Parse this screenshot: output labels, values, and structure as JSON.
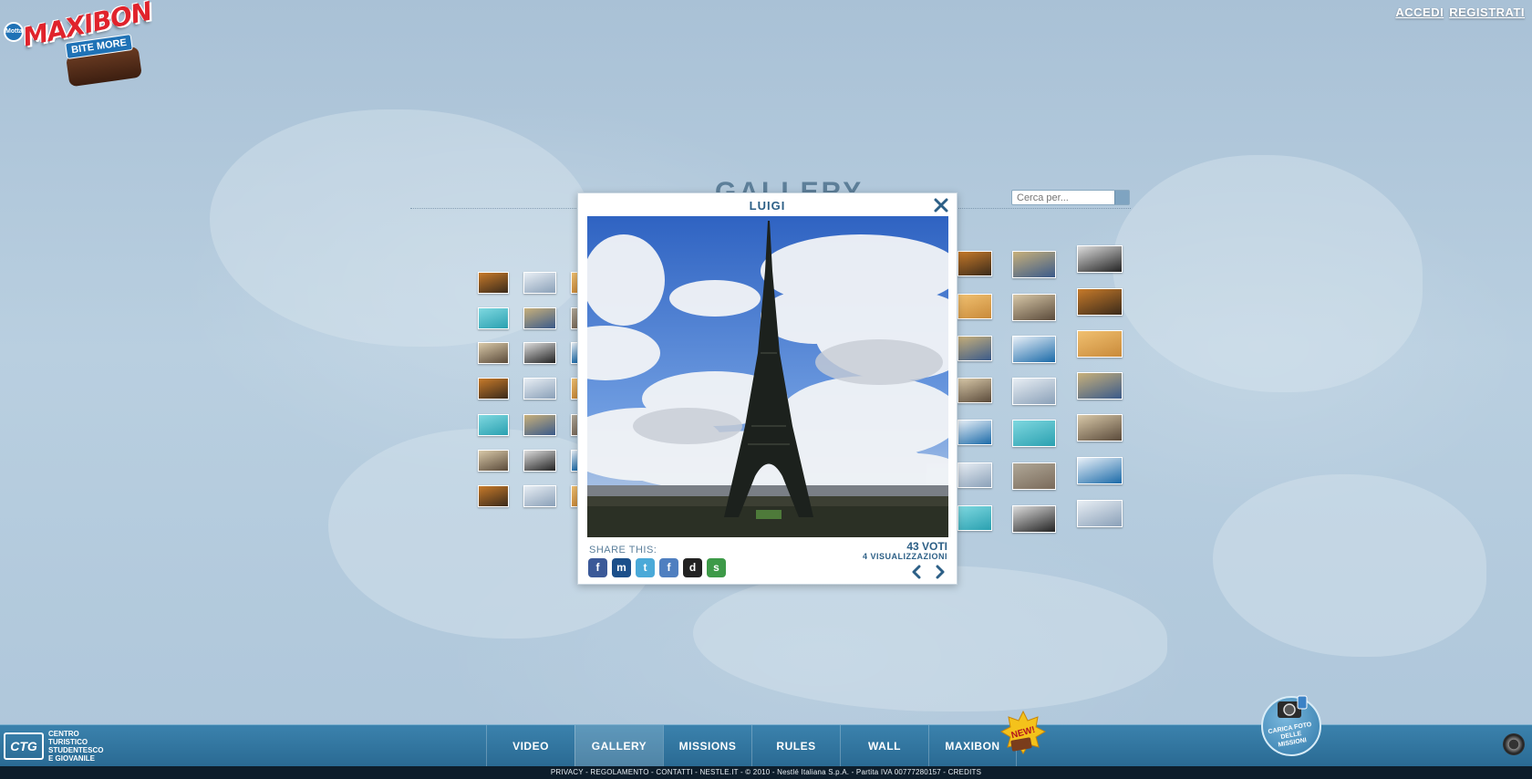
{
  "header": {
    "logo_text": "MAXIBON",
    "logo_sub": "BITE MORE",
    "logo_badge": "Motta",
    "login_label": "ACCEDI",
    "register_label": "REGISTRATI"
  },
  "gallery": {
    "title": "GALLERY",
    "search_placeholder": "Cerca per..."
  },
  "modal": {
    "title": "LUIGI",
    "share_label": "SHARE THIS:",
    "votes": "43 VOTI",
    "views": "4 VISUALIZZAZIONI",
    "share_services": [
      {
        "name": "facebook-icon",
        "glyph": "f",
        "color": "#3b5998"
      },
      {
        "name": "myspace-icon",
        "glyph": "m",
        "color": "#1b4f8a"
      },
      {
        "name": "twitter-icon",
        "glyph": "t",
        "color": "#4aa9d8"
      },
      {
        "name": "friendfeed-icon",
        "glyph": "f",
        "color": "#4f7fc0"
      },
      {
        "name": "delicious-icon",
        "glyph": "d",
        "color": "#222222"
      },
      {
        "name": "stumbleupon-icon",
        "glyph": "s",
        "color": "#3d9a48"
      }
    ]
  },
  "bottom_nav": {
    "ctg_abbr": "CTG",
    "ctg_line1": "CENTRO",
    "ctg_line2": "TURISTICO",
    "ctg_line3": "STUDENTESCO",
    "ctg_line4": "E GIOVANILE",
    "items": [
      {
        "label": "VIDEO",
        "active": false
      },
      {
        "label": "GALLERY",
        "active": true
      },
      {
        "label": "MISSIONS",
        "active": false
      },
      {
        "label": "RULES",
        "active": false
      },
      {
        "label": "WALL",
        "active": false
      },
      {
        "label": "MAXIBON",
        "active": false
      }
    ],
    "new_badge": "NEW!",
    "upload_line1": "CARICA FOTO",
    "upload_line2": "DELLE",
    "upload_line3": "MISSIONI"
  },
  "footer": {
    "text": "PRIVACY - REGOLAMENTO - CONTATTI - NESTLE.IT - © 2010 - Nestlé Italiana S.p.A. - Partita IVA 00777280157 - CREDITS"
  },
  "colors": {
    "accent": "#2c5f86",
    "nav_bg": "#2f77a3",
    "footer_bg": "#0d1d2b"
  }
}
